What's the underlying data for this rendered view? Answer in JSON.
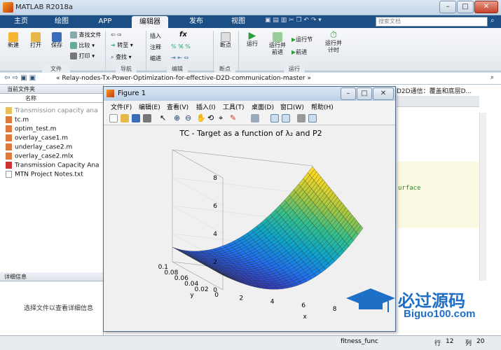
{
  "window": {
    "title": "MATLAB R2018a"
  },
  "tabs": [
    {
      "label": "主页"
    },
    {
      "label": "绘图"
    },
    {
      "label": "APP"
    },
    {
      "label": "编辑器"
    },
    {
      "label": "发布"
    },
    {
      "label": "视图"
    }
  ],
  "search": {
    "placeholder": "搜索文档"
  },
  "ribbon": {
    "file": {
      "new": "新建",
      "open": "打开",
      "save": "保存",
      "find_files": "查找文件",
      "compare": "比较",
      "print": "打印",
      "group": "文件"
    },
    "nav": {
      "goto": "转至",
      "find": "查找",
      "group": "导航"
    },
    "edit": {
      "insert": "插入",
      "comment": "注释",
      "indent": "缩进",
      "fx": "fx",
      "group": "编辑"
    },
    "breakpoints": {
      "label": "断点",
      "group": "断点"
    },
    "run": {
      "run": "运行",
      "run_advance": "运行并前进",
      "run_section": "运行节",
      "advance": "前进",
      "run_time": "运行并计时",
      "group": "运行"
    }
  },
  "address": {
    "path": "« Relay-nodes-Tx-Power-Optimization-for-effective-D2D-communication-master »"
  },
  "left": {
    "header": "当前文件夹",
    "col": "名称",
    "files": [
      "Transmission capacity ana",
      "tc.m",
      "optim_test.m",
      "overlay_case1.m",
      "underlay_case2.m",
      "overlay_case2.mlx",
      "Transmission Capacity Ana",
      "MTN Project Notes.txt"
    ]
  },
  "details": {
    "header": "详细信息",
    "empty": "选择文件以查看详细信息"
  },
  "editor": {
    "tab_text": "D2D通信：覆盖和底层D...",
    "code_frag": "urface"
  },
  "figure": {
    "title": "Figure 1",
    "menu": [
      "文件(F)",
      "编辑(E)",
      "查看(V)",
      "插入(I)",
      "工具(T)",
      "桌面(D)",
      "窗口(W)",
      "帮助(H)"
    ],
    "plot_title": "TC - Target as a function of λ₂ and P2",
    "zticks": [
      "0",
      "2",
      "4",
      "6",
      "8"
    ],
    "yticks": [
      "0",
      "0.02",
      "0.04",
      "0.06",
      "0.08",
      "0.1"
    ],
    "xticks": [
      "2",
      "4",
      "6",
      "8"
    ],
    "xlabel": "x",
    "ylabel": "y"
  },
  "status": {
    "func": "fitness_func",
    "row_label": "行",
    "row": "12",
    "col_label": "列",
    "col": "20"
  },
  "watermark": {
    "name": "必过源码",
    "url": "Biguo100.com"
  },
  "chart_data": {
    "type": "surface",
    "title": "TC - Target as a function of λ₂ and P2",
    "xlabel": "x",
    "ylabel": "y",
    "zlim": [
      0,
      8
    ],
    "xlim": [
      1,
      10
    ],
    "ylim": [
      0,
      0.1
    ],
    "colormap": "parula"
  }
}
